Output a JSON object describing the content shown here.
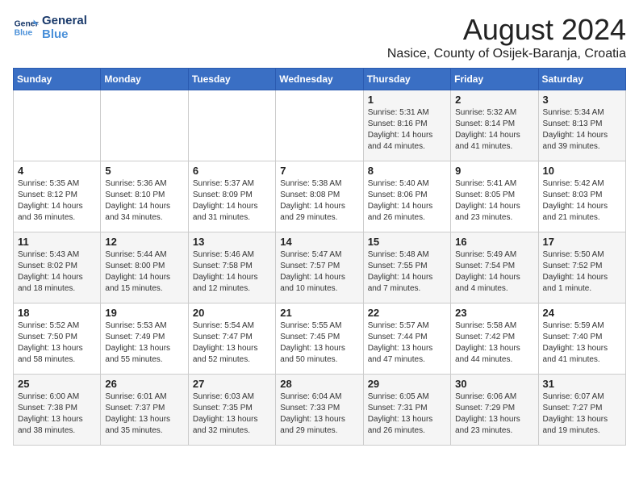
{
  "header": {
    "logo_line1": "General",
    "logo_line2": "Blue",
    "month_year": "August 2024",
    "location": "Nasice, County of Osijek-Baranja, Croatia"
  },
  "weekdays": [
    "Sunday",
    "Monday",
    "Tuesday",
    "Wednesday",
    "Thursday",
    "Friday",
    "Saturday"
  ],
  "weeks": [
    [
      {
        "day": "",
        "info": ""
      },
      {
        "day": "",
        "info": ""
      },
      {
        "day": "",
        "info": ""
      },
      {
        "day": "",
        "info": ""
      },
      {
        "day": "1",
        "info": "Sunrise: 5:31 AM\nSunset: 8:16 PM\nDaylight: 14 hours\nand 44 minutes."
      },
      {
        "day": "2",
        "info": "Sunrise: 5:32 AM\nSunset: 8:14 PM\nDaylight: 14 hours\nand 41 minutes."
      },
      {
        "day": "3",
        "info": "Sunrise: 5:34 AM\nSunset: 8:13 PM\nDaylight: 14 hours\nand 39 minutes."
      }
    ],
    [
      {
        "day": "4",
        "info": "Sunrise: 5:35 AM\nSunset: 8:12 PM\nDaylight: 14 hours\nand 36 minutes."
      },
      {
        "day": "5",
        "info": "Sunrise: 5:36 AM\nSunset: 8:10 PM\nDaylight: 14 hours\nand 34 minutes."
      },
      {
        "day": "6",
        "info": "Sunrise: 5:37 AM\nSunset: 8:09 PM\nDaylight: 14 hours\nand 31 minutes."
      },
      {
        "day": "7",
        "info": "Sunrise: 5:38 AM\nSunset: 8:08 PM\nDaylight: 14 hours\nand 29 minutes."
      },
      {
        "day": "8",
        "info": "Sunrise: 5:40 AM\nSunset: 8:06 PM\nDaylight: 14 hours\nand 26 minutes."
      },
      {
        "day": "9",
        "info": "Sunrise: 5:41 AM\nSunset: 8:05 PM\nDaylight: 14 hours\nand 23 minutes."
      },
      {
        "day": "10",
        "info": "Sunrise: 5:42 AM\nSunset: 8:03 PM\nDaylight: 14 hours\nand 21 minutes."
      }
    ],
    [
      {
        "day": "11",
        "info": "Sunrise: 5:43 AM\nSunset: 8:02 PM\nDaylight: 14 hours\nand 18 minutes."
      },
      {
        "day": "12",
        "info": "Sunrise: 5:44 AM\nSunset: 8:00 PM\nDaylight: 14 hours\nand 15 minutes."
      },
      {
        "day": "13",
        "info": "Sunrise: 5:46 AM\nSunset: 7:58 PM\nDaylight: 14 hours\nand 12 minutes."
      },
      {
        "day": "14",
        "info": "Sunrise: 5:47 AM\nSunset: 7:57 PM\nDaylight: 14 hours\nand 10 minutes."
      },
      {
        "day": "15",
        "info": "Sunrise: 5:48 AM\nSunset: 7:55 PM\nDaylight: 14 hours\nand 7 minutes."
      },
      {
        "day": "16",
        "info": "Sunrise: 5:49 AM\nSunset: 7:54 PM\nDaylight: 14 hours\nand 4 minutes."
      },
      {
        "day": "17",
        "info": "Sunrise: 5:50 AM\nSunset: 7:52 PM\nDaylight: 14 hours\nand 1 minute."
      }
    ],
    [
      {
        "day": "18",
        "info": "Sunrise: 5:52 AM\nSunset: 7:50 PM\nDaylight: 13 hours\nand 58 minutes."
      },
      {
        "day": "19",
        "info": "Sunrise: 5:53 AM\nSunset: 7:49 PM\nDaylight: 13 hours\nand 55 minutes."
      },
      {
        "day": "20",
        "info": "Sunrise: 5:54 AM\nSunset: 7:47 PM\nDaylight: 13 hours\nand 52 minutes."
      },
      {
        "day": "21",
        "info": "Sunrise: 5:55 AM\nSunset: 7:45 PM\nDaylight: 13 hours\nand 50 minutes."
      },
      {
        "day": "22",
        "info": "Sunrise: 5:57 AM\nSunset: 7:44 PM\nDaylight: 13 hours\nand 47 minutes."
      },
      {
        "day": "23",
        "info": "Sunrise: 5:58 AM\nSunset: 7:42 PM\nDaylight: 13 hours\nand 44 minutes."
      },
      {
        "day": "24",
        "info": "Sunrise: 5:59 AM\nSunset: 7:40 PM\nDaylight: 13 hours\nand 41 minutes."
      }
    ],
    [
      {
        "day": "25",
        "info": "Sunrise: 6:00 AM\nSunset: 7:38 PM\nDaylight: 13 hours\nand 38 minutes."
      },
      {
        "day": "26",
        "info": "Sunrise: 6:01 AM\nSunset: 7:37 PM\nDaylight: 13 hours\nand 35 minutes."
      },
      {
        "day": "27",
        "info": "Sunrise: 6:03 AM\nSunset: 7:35 PM\nDaylight: 13 hours\nand 32 minutes."
      },
      {
        "day": "28",
        "info": "Sunrise: 6:04 AM\nSunset: 7:33 PM\nDaylight: 13 hours\nand 29 minutes."
      },
      {
        "day": "29",
        "info": "Sunrise: 6:05 AM\nSunset: 7:31 PM\nDaylight: 13 hours\nand 26 minutes."
      },
      {
        "day": "30",
        "info": "Sunrise: 6:06 AM\nSunset: 7:29 PM\nDaylight: 13 hours\nand 23 minutes."
      },
      {
        "day": "31",
        "info": "Sunrise: 6:07 AM\nSunset: 7:27 PM\nDaylight: 13 hours\nand 19 minutes."
      }
    ]
  ]
}
